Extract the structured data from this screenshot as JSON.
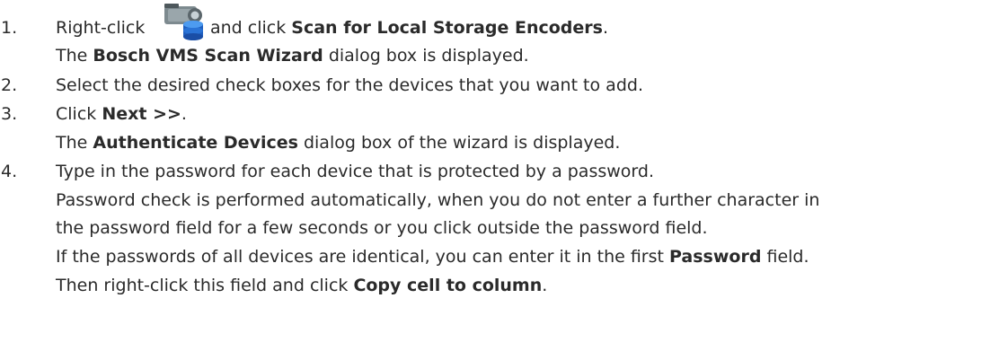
{
  "steps": [
    {
      "number": "1.",
      "lines": [
        {
          "pre": "Right-click",
          "mid": "and click ",
          "bold": "Scan for Local Storage Encoders",
          "post": "."
        },
        {
          "pre": "The ",
          "bold": "Bosch VMS Scan Wizard",
          "post": " dialog box is displayed."
        }
      ],
      "icon": "storage-encoder-icon"
    },
    {
      "number": "2.",
      "text": "Select the desired check boxes for the devices that you want to add."
    },
    {
      "number": "3.",
      "lines": [
        {
          "pre": "Click ",
          "bold": "Next >>",
          "post": "."
        },
        {
          "pre": "The ",
          "bold": "Authenticate Devices",
          "post": " dialog box of the wizard is displayed."
        }
      ]
    },
    {
      "number": "4.",
      "lines": [
        "Type in the password for each device that is protected by a password.",
        "Password check is performed automatically, when you do not enter a further character in",
        "the password field for a few seconds or you click outside the password field.",
        {
          "pre": "If the passwords of all devices are identical, you can enter it in the first ",
          "bold": "Password",
          "post": " field."
        },
        {
          "pre": "Then right-click this field and click ",
          "bold": "Copy cell to column",
          "post": "."
        }
      ]
    }
  ]
}
